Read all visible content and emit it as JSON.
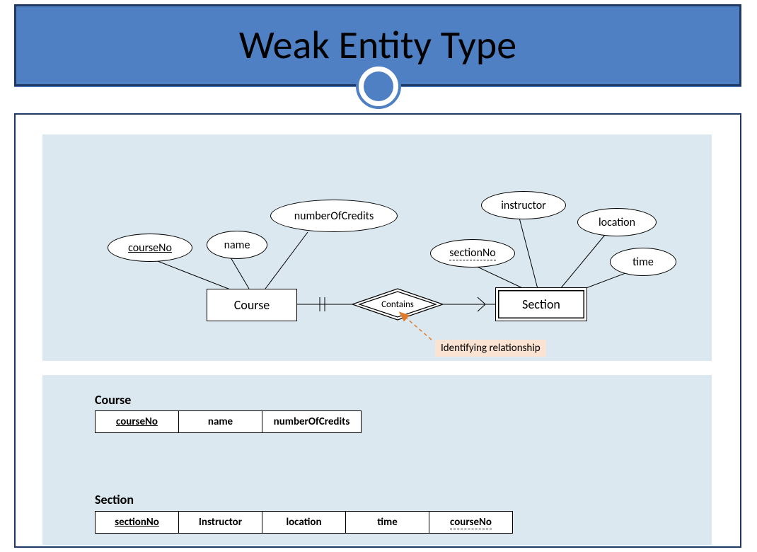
{
  "title": "Weak Entity Type",
  "er": {
    "strongEntity": "Course",
    "weakEntity": "Section",
    "relationship": "Contains",
    "annotation": "Identifying relationship",
    "courseAttrs": {
      "courseNo": "courseNo",
      "name": "name",
      "numberOfCredits": "numberOfCredits"
    },
    "sectionAttrs": {
      "sectionNo": "sectionNo",
      "instructor": "instructor",
      "location": "location",
      "time": "time"
    }
  },
  "schema": {
    "course": {
      "name": "Course",
      "cols": [
        "courseNo",
        "name",
        "numberOfCredits"
      ]
    },
    "section": {
      "name": "Section",
      "cols": [
        "sectionNo",
        "Instructor",
        "location",
        "time",
        "courseNo"
      ]
    }
  }
}
